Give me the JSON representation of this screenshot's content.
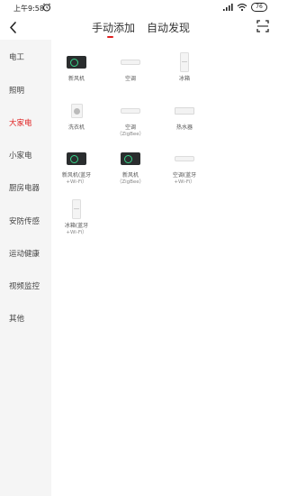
{
  "status_bar": {
    "time": "上午9:58",
    "battery": "76"
  },
  "tabs": [
    {
      "label": "手动添加",
      "active": true
    },
    {
      "label": "自动发现",
      "active": false
    }
  ],
  "accent_color": "#e02020",
  "categories": [
    {
      "label": "电工",
      "active": false
    },
    {
      "label": "照明",
      "active": false
    },
    {
      "label": "大家电",
      "active": true
    },
    {
      "label": "小家电",
      "active": false
    },
    {
      "label": "厨房电器",
      "active": false
    },
    {
      "label": "安防传感",
      "active": false
    },
    {
      "label": "运动健康",
      "active": false
    },
    {
      "label": "视频监控",
      "active": false
    },
    {
      "label": "其他",
      "active": false
    }
  ],
  "devices": [
    {
      "icon": "fresh-air-icon",
      "label": "新风机",
      "sub": ""
    },
    {
      "icon": "air-conditioner-icon",
      "label": "空调",
      "sub": ""
    },
    {
      "icon": "fridge-icon",
      "label": "冰箱",
      "sub": ""
    },
    {
      "icon": "washing-machine-icon",
      "label": "洗衣机",
      "sub": ""
    },
    {
      "icon": "air-conditioner-icon",
      "label": "空调",
      "sub": "（ZigBee）"
    },
    {
      "icon": "water-heater-icon",
      "label": "热水器",
      "sub": ""
    },
    {
      "icon": "fresh-air-icon",
      "label": "新风机(蓝牙",
      "sub": "+Wi-Fi）"
    },
    {
      "icon": "fresh-air-icon",
      "label": "新风机",
      "sub": "（ZigBee）"
    },
    {
      "icon": "air-conditioner-icon",
      "label": "空调(蓝牙",
      "sub": "+Wi-Fi）"
    },
    {
      "icon": "fridge-icon",
      "label": "冰箱(蓝牙",
      "sub": "+Wi-Fi）"
    }
  ]
}
